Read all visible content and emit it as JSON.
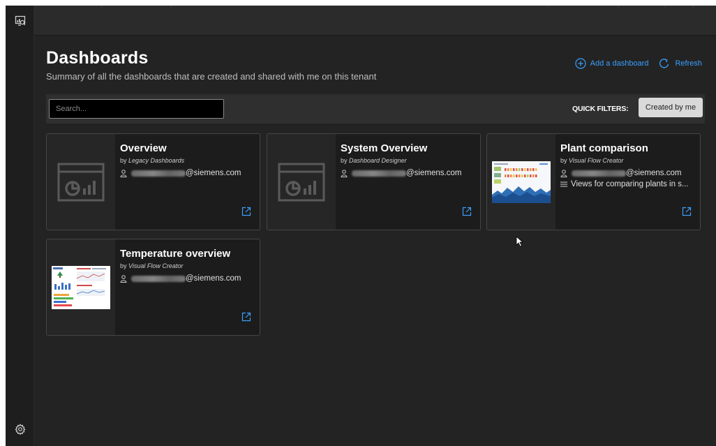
{
  "page": {
    "title": "Dashboards",
    "subtitle": "Summary of all the dashboards that are created and shared with me on this tenant"
  },
  "actions": {
    "add_label": "Add a dashboard",
    "refresh_label": "Refresh"
  },
  "filters": {
    "search_placeholder": "Search...",
    "quick_filters_label": "QUICK FILTERS:",
    "chip_label": "Created by me"
  },
  "cards": [
    {
      "title": "Overview",
      "by_prefix": "by",
      "source": "Legacy Dashboards",
      "email_domain": "@siemens.com",
      "description": "",
      "thumbnail": "dashboard-placeholder-icon"
    },
    {
      "title": "System Overview",
      "by_prefix": "by",
      "source": "Dashboard Designer",
      "email_domain": "@siemens.com",
      "description": "",
      "thumbnail": "dashboard-placeholder-icon"
    },
    {
      "title": "Plant comparison",
      "by_prefix": "by",
      "source": "Visual Flow Creator",
      "email_domain": "@siemens.com",
      "description": "Views for comparing plants in s...",
      "thumbnail": "plant-dashboard-preview"
    },
    {
      "title": "Temperature overview",
      "by_prefix": "by",
      "source": "Visual Flow Creator",
      "email_domain": "@siemens.com",
      "description": "",
      "thumbnail": "temperature-dashboard-preview"
    }
  ],
  "colors": {
    "accent": "#3aa0ff",
    "background": "#232323",
    "card": "#1c1c1c",
    "sidebar": "#1e1e1e"
  }
}
